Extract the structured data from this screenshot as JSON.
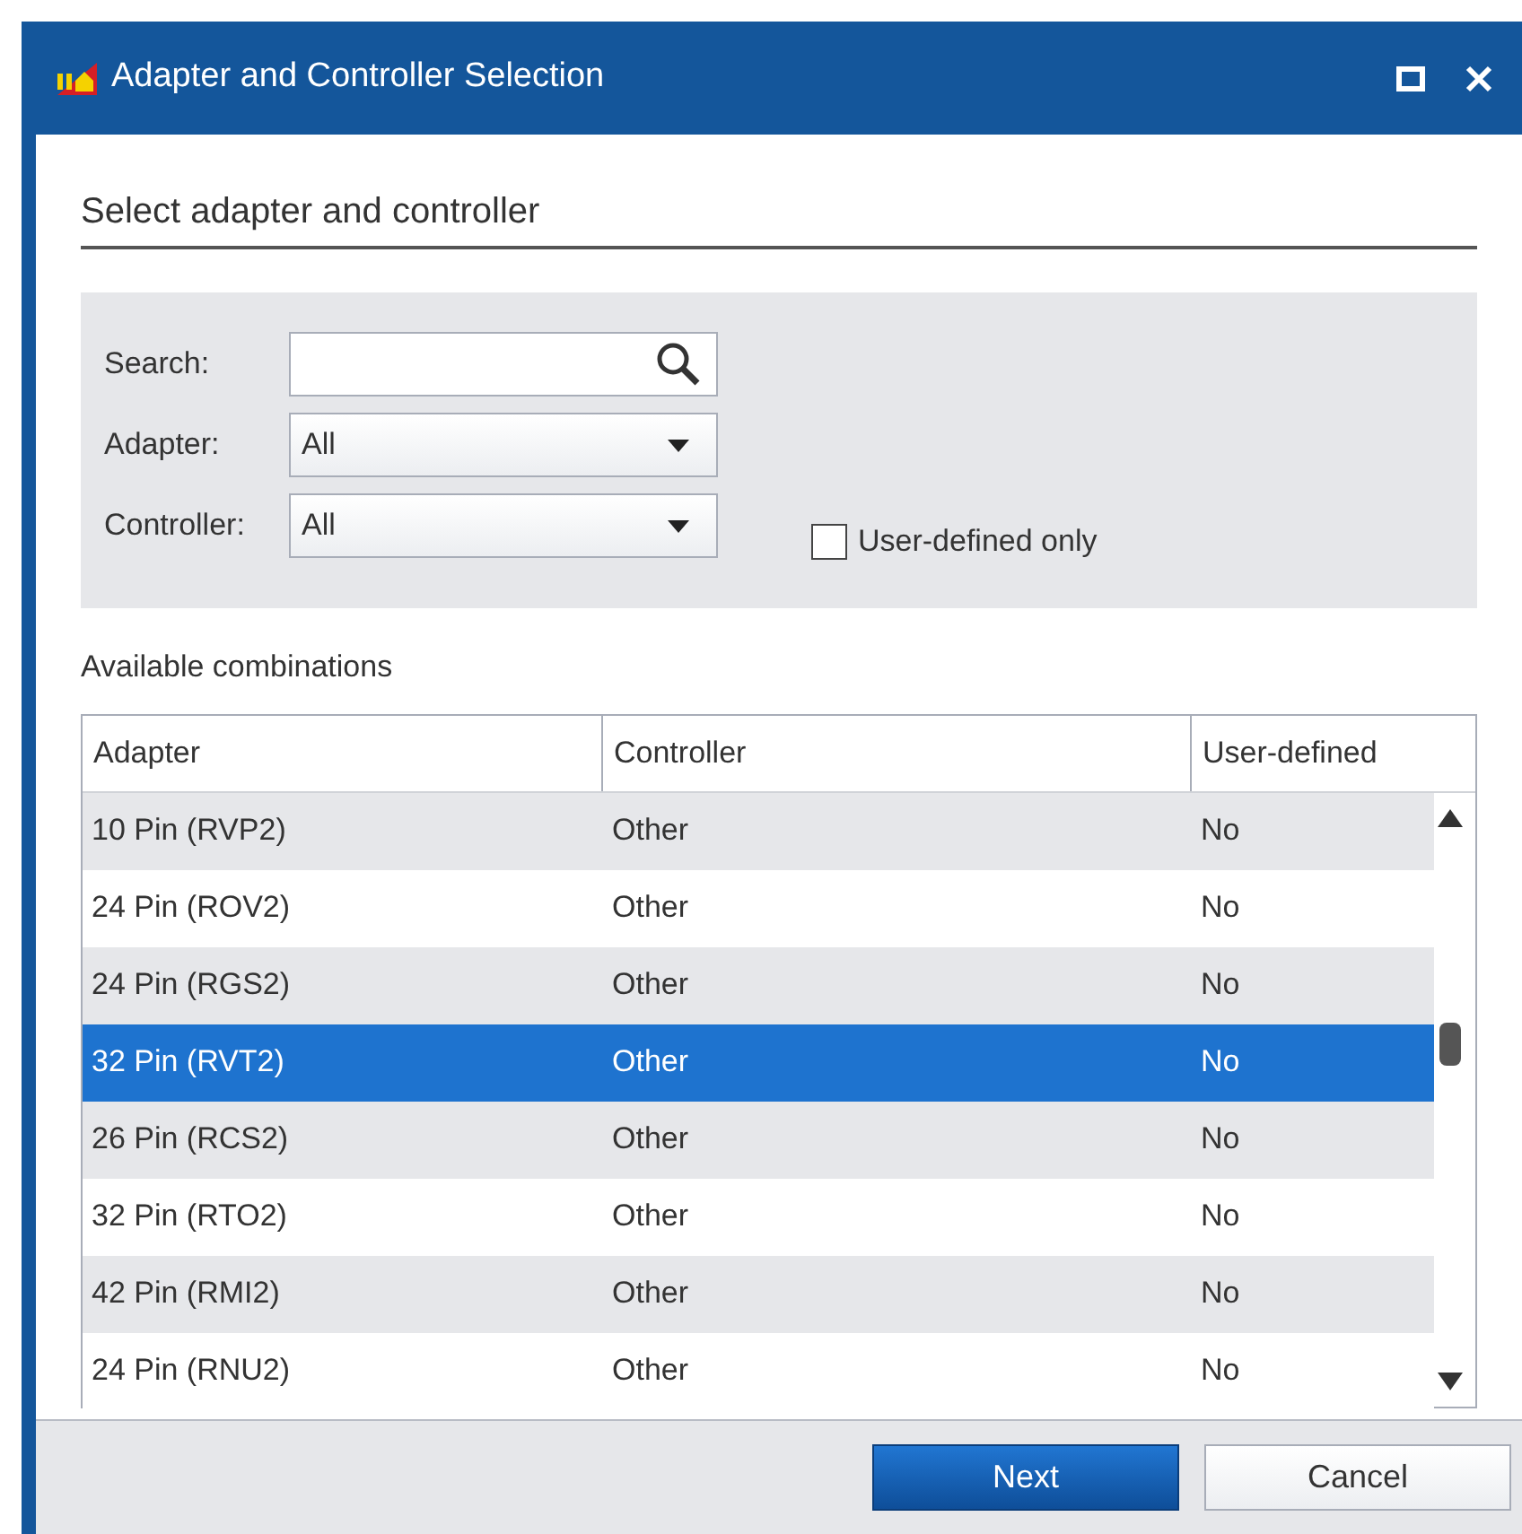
{
  "window": {
    "title": "Adapter and Controller Selection"
  },
  "section_title": "Select adapter and controller",
  "filters": {
    "search": {
      "label": "Search:"
    },
    "adapter": {
      "label": "Adapter:",
      "value": "All"
    },
    "controller": {
      "label": "Controller:",
      "value": "All"
    },
    "user_defined_only": {
      "label": "User-defined only",
      "checked": false
    }
  },
  "table": {
    "title": "Available combinations",
    "columns": [
      "Adapter",
      "Controller",
      "User-defined"
    ],
    "rows": [
      {
        "cells": [
          "10 Pin (RVP2)",
          "Other",
          "No"
        ],
        "selected": false
      },
      {
        "cells": [
          "24 Pin (ROV2)",
          "Other",
          "No"
        ],
        "selected": false
      },
      {
        "cells": [
          "24 Pin (RGS2)",
          "Other",
          "No"
        ],
        "selected": false
      },
      {
        "cells": [
          "32 Pin (RVT2)",
          "Other",
          "No"
        ],
        "selected": true
      },
      {
        "cells": [
          "26 Pin (RCS2)",
          "Other",
          "No"
        ],
        "selected": false
      },
      {
        "cells": [
          "32 Pin (RTO2)",
          "Other",
          "No"
        ],
        "selected": false
      },
      {
        "cells": [
          "42 Pin (RMI2)",
          "Other",
          "No"
        ],
        "selected": false
      },
      {
        "cells": [
          "24 Pin (RNU2)",
          "Other",
          "No"
        ],
        "selected": false
      }
    ]
  },
  "buttons": [
    {
      "label": "Next",
      "kind": "primary"
    },
    {
      "label": "Cancel",
      "kind": "secondary"
    }
  ]
}
